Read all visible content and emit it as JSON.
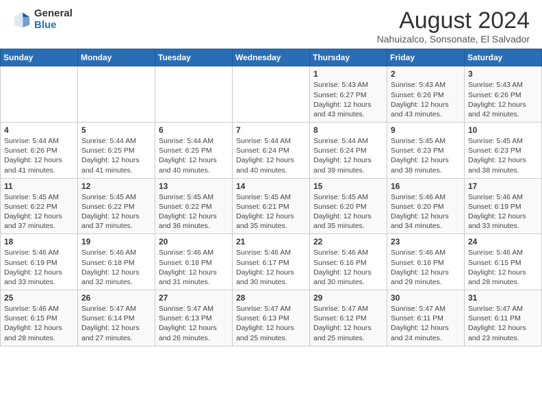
{
  "header": {
    "logo_general": "General",
    "logo_blue": "Blue",
    "title": "August 2024",
    "location": "Nahuizalco, Sonsonate, El Salvador"
  },
  "days_of_week": [
    "Sunday",
    "Monday",
    "Tuesday",
    "Wednesday",
    "Thursday",
    "Friday",
    "Saturday"
  ],
  "weeks": [
    [
      {
        "date": "",
        "info": ""
      },
      {
        "date": "",
        "info": ""
      },
      {
        "date": "",
        "info": ""
      },
      {
        "date": "",
        "info": ""
      },
      {
        "date": "1",
        "info": "Sunrise: 5:43 AM\nSunset: 6:27 PM\nDaylight: 12 hours and 43 minutes."
      },
      {
        "date": "2",
        "info": "Sunrise: 5:43 AM\nSunset: 6:26 PM\nDaylight: 12 hours and 43 minutes."
      },
      {
        "date": "3",
        "info": "Sunrise: 5:43 AM\nSunset: 6:26 PM\nDaylight: 12 hours and 42 minutes."
      }
    ],
    [
      {
        "date": "4",
        "info": "Sunrise: 5:44 AM\nSunset: 6:26 PM\nDaylight: 12 hours and 41 minutes."
      },
      {
        "date": "5",
        "info": "Sunrise: 5:44 AM\nSunset: 6:25 PM\nDaylight: 12 hours and 41 minutes."
      },
      {
        "date": "6",
        "info": "Sunrise: 5:44 AM\nSunset: 6:25 PM\nDaylight: 12 hours and 40 minutes."
      },
      {
        "date": "7",
        "info": "Sunrise: 5:44 AM\nSunset: 6:24 PM\nDaylight: 12 hours and 40 minutes."
      },
      {
        "date": "8",
        "info": "Sunrise: 5:44 AM\nSunset: 6:24 PM\nDaylight: 12 hours and 39 minutes."
      },
      {
        "date": "9",
        "info": "Sunrise: 5:45 AM\nSunset: 6:23 PM\nDaylight: 12 hours and 38 minutes."
      },
      {
        "date": "10",
        "info": "Sunrise: 5:45 AM\nSunset: 6:23 PM\nDaylight: 12 hours and 38 minutes."
      }
    ],
    [
      {
        "date": "11",
        "info": "Sunrise: 5:45 AM\nSunset: 6:22 PM\nDaylight: 12 hours and 37 minutes."
      },
      {
        "date": "12",
        "info": "Sunrise: 5:45 AM\nSunset: 6:22 PM\nDaylight: 12 hours and 37 minutes."
      },
      {
        "date": "13",
        "info": "Sunrise: 5:45 AM\nSunset: 6:22 PM\nDaylight: 12 hours and 36 minutes."
      },
      {
        "date": "14",
        "info": "Sunrise: 5:45 AM\nSunset: 6:21 PM\nDaylight: 12 hours and 35 minutes."
      },
      {
        "date": "15",
        "info": "Sunrise: 5:45 AM\nSunset: 6:20 PM\nDaylight: 12 hours and 35 minutes."
      },
      {
        "date": "16",
        "info": "Sunrise: 5:46 AM\nSunset: 6:20 PM\nDaylight: 12 hours and 34 minutes."
      },
      {
        "date": "17",
        "info": "Sunrise: 5:46 AM\nSunset: 6:19 PM\nDaylight: 12 hours and 33 minutes."
      }
    ],
    [
      {
        "date": "18",
        "info": "Sunrise: 5:46 AM\nSunset: 6:19 PM\nDaylight: 12 hours and 33 minutes."
      },
      {
        "date": "19",
        "info": "Sunrise: 5:46 AM\nSunset: 6:18 PM\nDaylight: 12 hours and 32 minutes."
      },
      {
        "date": "20",
        "info": "Sunrise: 5:46 AM\nSunset: 6:18 PM\nDaylight: 12 hours and 31 minutes."
      },
      {
        "date": "21",
        "info": "Sunrise: 5:46 AM\nSunset: 6:17 PM\nDaylight: 12 hours and 30 minutes."
      },
      {
        "date": "22",
        "info": "Sunrise: 5:46 AM\nSunset: 6:16 PM\nDaylight: 12 hours and 30 minutes."
      },
      {
        "date": "23",
        "info": "Sunrise: 5:46 AM\nSunset: 6:16 PM\nDaylight: 12 hours and 29 minutes."
      },
      {
        "date": "24",
        "info": "Sunrise: 5:46 AM\nSunset: 6:15 PM\nDaylight: 12 hours and 28 minutes."
      }
    ],
    [
      {
        "date": "25",
        "info": "Sunrise: 5:46 AM\nSunset: 6:15 PM\nDaylight: 12 hours and 28 minutes."
      },
      {
        "date": "26",
        "info": "Sunrise: 5:47 AM\nSunset: 6:14 PM\nDaylight: 12 hours and 27 minutes."
      },
      {
        "date": "27",
        "info": "Sunrise: 5:47 AM\nSunset: 6:13 PM\nDaylight: 12 hours and 26 minutes."
      },
      {
        "date": "28",
        "info": "Sunrise: 5:47 AM\nSunset: 6:13 PM\nDaylight: 12 hours and 25 minutes."
      },
      {
        "date": "29",
        "info": "Sunrise: 5:47 AM\nSunset: 6:12 PM\nDaylight: 12 hours and 25 minutes."
      },
      {
        "date": "30",
        "info": "Sunrise: 5:47 AM\nSunset: 6:11 PM\nDaylight: 12 hours and 24 minutes."
      },
      {
        "date": "31",
        "info": "Sunrise: 5:47 AM\nSunset: 6:11 PM\nDaylight: 12 hours and 23 minutes."
      }
    ]
  ]
}
